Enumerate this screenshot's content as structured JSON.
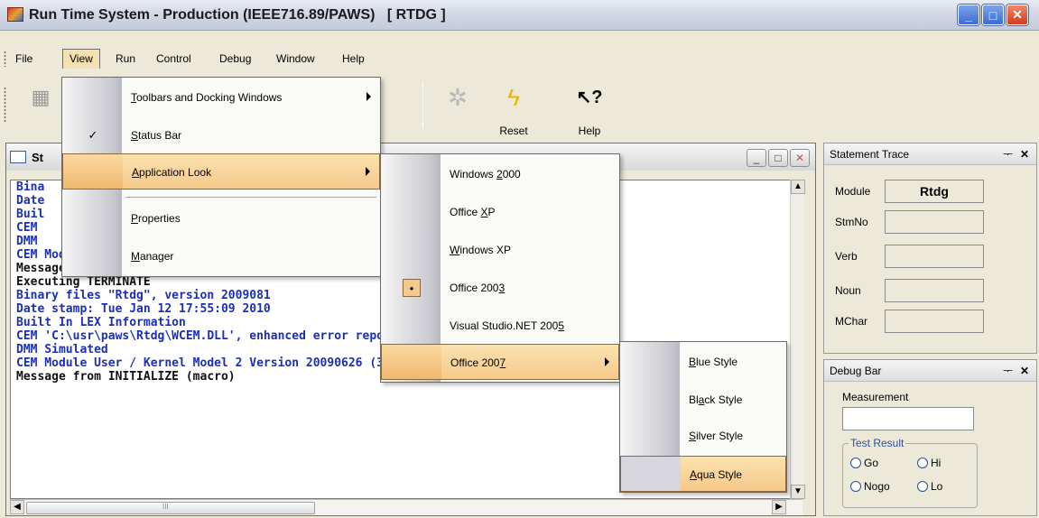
{
  "window": {
    "title": "Run Time System - Production (IEEE716.89/PAWS)   [ RTDG ]",
    "minimize_glyph": "_",
    "maximize_glyph": "□",
    "close_glyph": "✕"
  },
  "menubar": {
    "items": [
      "File",
      "View",
      "Run",
      "Control",
      "Debug",
      "Window",
      "Help"
    ]
  },
  "toolbar": {
    "buttons": [
      {
        "label": "Reset",
        "icon": "lightning-icon"
      },
      {
        "label": "Help",
        "icon": "help-pointer-icon"
      }
    ]
  },
  "view_menu": {
    "items": [
      {
        "label": "Toolbars and Docking Windows",
        "underline": "T",
        "rest": "oolbars and Docking Windows",
        "submenu": true
      },
      {
        "label": "Status Bar",
        "underline": "S",
        "rest": "tatus Bar",
        "checked": true
      },
      {
        "label": "Application Look",
        "underline": "A",
        "rest": "pplication Look",
        "submenu": true,
        "highlighted": true
      },
      {
        "label": "Properties",
        "underline": "P",
        "rest": "roperties"
      },
      {
        "label": "Manager",
        "underline": "M",
        "rest": "anager"
      }
    ]
  },
  "app_look_menu": {
    "items": [
      {
        "pre": "Windows ",
        "u": "2",
        "post": "000"
      },
      {
        "pre": "Office ",
        "u": "X",
        "post": "P"
      },
      {
        "pre": "",
        "u": "W",
        "post": "indows XP"
      },
      {
        "pre": "Office 200",
        "u": "3",
        "post": "",
        "selected": true
      },
      {
        "pre": "Visual Studio.NET 200",
        "u": "5",
        "post": ""
      },
      {
        "pre": "Office 200",
        "u": "7",
        "post": "",
        "submenu": true,
        "highlighted": true
      }
    ]
  },
  "office2007_menu": {
    "items": [
      {
        "pre": "",
        "u": "B",
        "post": "lue Style"
      },
      {
        "pre": "Bl",
        "u": "a",
        "post": "ck Style"
      },
      {
        "pre": "",
        "u": "S",
        "post": "ilver Style"
      },
      {
        "pre": "",
        "u": "A",
        "post": "qua Style",
        "highlighted": true
      }
    ]
  },
  "child_window": {
    "title": "St",
    "lines": [
      {
        "text": "Bina",
        "color": "blue"
      },
      {
        "text": "Date",
        "color": "blue"
      },
      {
        "text": "Buil",
        "color": "blue"
      },
      {
        "text": "CEM",
        "color": "blue"
      },
      {
        "text": "DMM",
        "color": "blue"
      },
      {
        "text": "CEM Module User / Kernel Model 2 Ver",
        "color": "blue"
      },
      {
        "text": "Message from INITIALIZE (macro)",
        "color": "black"
      },
      {
        "text": "Executing TERMINATE",
        "color": "black"
      },
      {
        "text": "Binary files \"Rtdg\", version 2009081",
        "color": "blue"
      },
      {
        "text": "Date stamp: Tue Jan 12 17:55:09 2010",
        "color": "blue"
      },
      {
        "text": "Built In LEX Information",
        "color": "blue"
      },
      {
        "text": "CEM 'C:\\usr\\paws\\Rtdg\\WCEM.DLL', enhanced error reporting",
        "color": "blue"
      },
      {
        "text": "DMM Simulated",
        "color": "blue"
      },
      {
        "text": "CEM Module User / Kernel Model 2 Version 20090626 (3.9.34)",
        "color": "blue"
      },
      {
        "text": "Message from INITIALIZE (macro)",
        "color": "black"
      }
    ],
    "hscroll_mark": "III"
  },
  "statement_trace": {
    "title": "Statement Trace",
    "pin": "ᅮ",
    "close": "✕",
    "fields": [
      {
        "label": "Module",
        "value": "Rtdg"
      },
      {
        "label": "StmNo",
        "value": ""
      },
      {
        "label": "Verb",
        "value": ""
      },
      {
        "label": "Noun",
        "value": ""
      },
      {
        "label": "MChar",
        "value": ""
      }
    ]
  },
  "debug_bar": {
    "title": "Debug Bar",
    "pin": "ᅮ",
    "close": "✕",
    "measurement_label": "Measurement",
    "test_result_label": "Test Result",
    "radios": [
      "Go",
      "Hi",
      "Nogo",
      "Lo"
    ]
  }
}
